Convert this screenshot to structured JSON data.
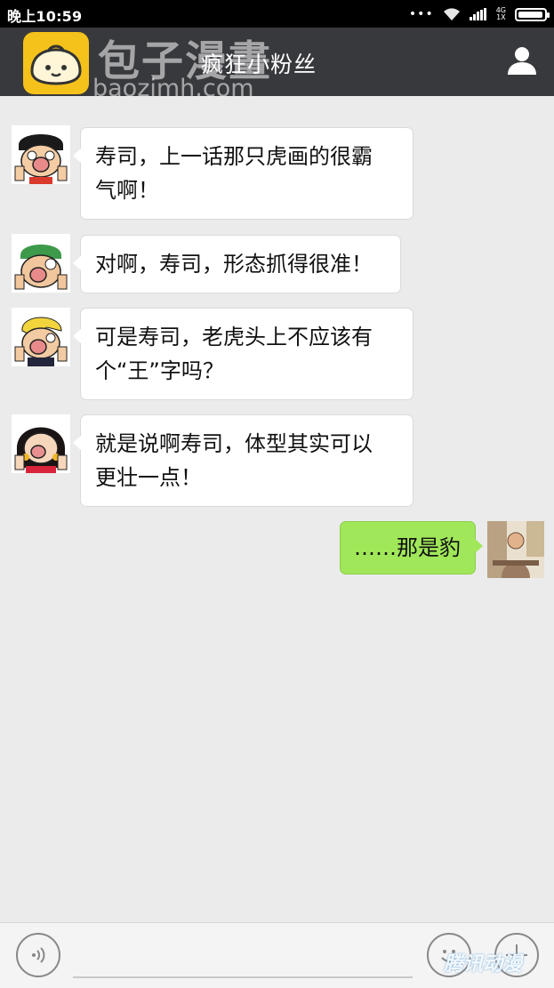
{
  "status_bar": {
    "time": "晚上10:59",
    "network_top": "4G",
    "network_bottom": "1X"
  },
  "header": {
    "title": "疯狂小粉丝"
  },
  "watermark": {
    "text": "包子漫畫",
    "url": "baozimh.com"
  },
  "messages": [
    {
      "sender": "luffy-avatar",
      "side": "left",
      "lines": [
        "寿司，上一话那只虎画的很霸",
        "气啊！"
      ]
    },
    {
      "sender": "zoro-avatar",
      "side": "left",
      "lines": [
        "对啊，寿司，形态抓得很准！"
      ]
    },
    {
      "sender": "sanji-avatar",
      "side": "left",
      "lines": [
        "可是寿司，老虎头上不应该有",
        "个“王”字吗？"
      ]
    },
    {
      "sender": "hancock-avatar",
      "side": "left",
      "lines": [
        "就是说啊寿司，体型其实可以",
        "更壮一点！"
      ]
    },
    {
      "sender": "self-avatar",
      "side": "right",
      "lines": [
        "……那是豹"
      ]
    }
  ],
  "input_bar": {
    "corner_watermark": "腾讯动漫"
  },
  "colors": {
    "nav_bg": "#38393d",
    "chat_bg": "#ebebeb",
    "sent_bubble": "#a0e759",
    "received_bubble": "#ffffff"
  },
  "battery_level": 0.95
}
